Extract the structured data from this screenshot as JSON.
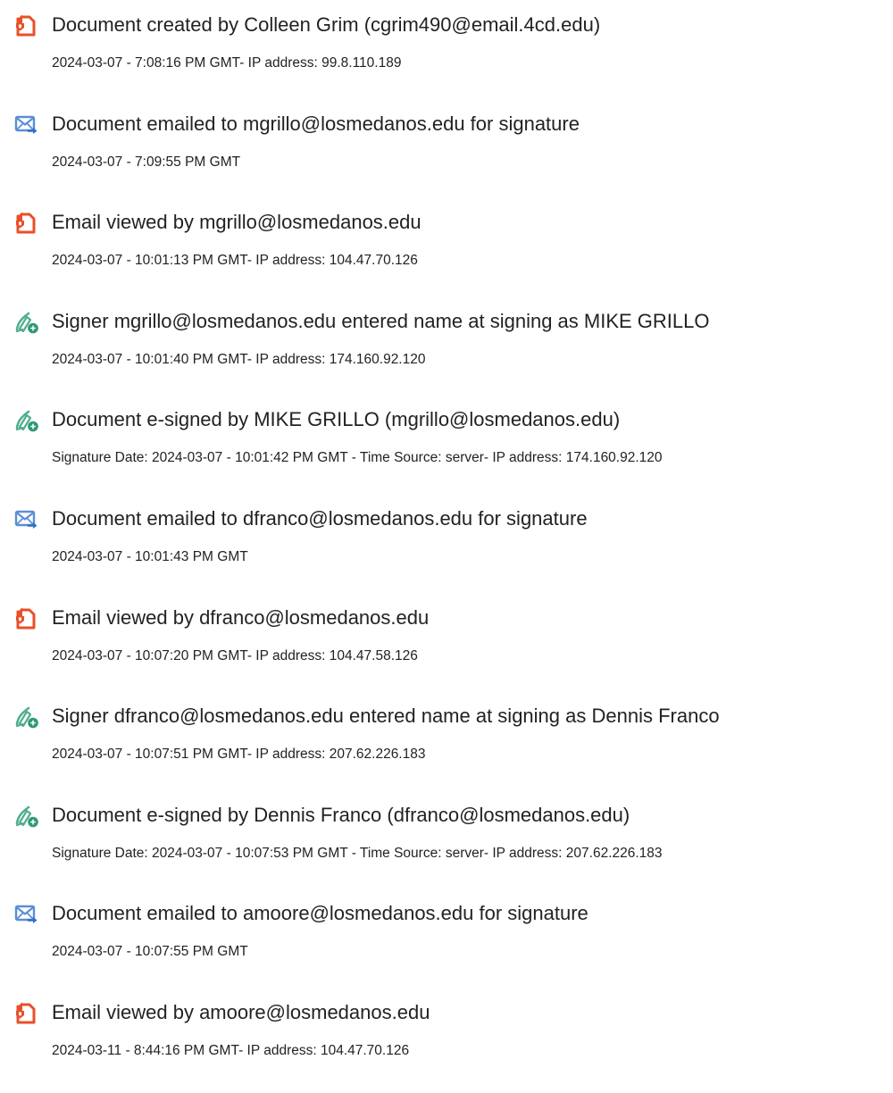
{
  "events": [
    {
      "icon": "document-created-icon",
      "title": "Document created by Colleen Grim (cgrim490@email.4cd.edu)",
      "detail": "2024-03-07 - 7:08:16 PM GMT- IP address: 99.8.110.189"
    },
    {
      "icon": "email-sent-icon",
      "title": "Document emailed to mgrillo@losmedanos.edu for signature",
      "detail": "2024-03-07 - 7:09:55 PM GMT"
    },
    {
      "icon": "document-viewed-icon",
      "title": "Email viewed by mgrillo@losmedanos.edu",
      "detail": "2024-03-07 - 10:01:13 PM GMT- IP address: 104.47.70.126"
    },
    {
      "icon": "signature-pen-icon",
      "title": "Signer mgrillo@losmedanos.edu entered name at signing as MIKE GRILLO",
      "detail": "2024-03-07 - 10:01:40 PM GMT- IP address: 174.160.92.120"
    },
    {
      "icon": "signature-pen-icon",
      "title": "Document e-signed by MIKE GRILLO (mgrillo@losmedanos.edu)",
      "detail": "Signature Date: 2024-03-07 - 10:01:42 PM GMT - Time Source: server- IP address: 174.160.92.120"
    },
    {
      "icon": "email-sent-icon",
      "title": "Document emailed to dfranco@losmedanos.edu for signature",
      "detail": "2024-03-07 - 10:01:43 PM GMT"
    },
    {
      "icon": "document-viewed-icon",
      "title": "Email viewed by dfranco@losmedanos.edu",
      "detail": "2024-03-07 - 10:07:20 PM GMT- IP address: 104.47.58.126"
    },
    {
      "icon": "signature-pen-icon",
      "title": "Signer dfranco@losmedanos.edu entered name at signing as Dennis Franco",
      "detail": "2024-03-07 - 10:07:51 PM GMT- IP address: 207.62.226.183"
    },
    {
      "icon": "signature-pen-icon",
      "title": "Document e-signed by Dennis Franco (dfranco@losmedanos.edu)",
      "detail": "Signature Date: 2024-03-07 - 10:07:53 PM GMT - Time Source: server- IP address: 207.62.226.183"
    },
    {
      "icon": "email-sent-icon",
      "title": "Document emailed to amoore@losmedanos.edu for signature",
      "detail": "2024-03-07 - 10:07:55 PM GMT"
    },
    {
      "icon": "document-viewed-icon",
      "title": "Email viewed by amoore@losmedanos.edu",
      "detail": "2024-03-11 - 8:44:16 PM GMT- IP address: 104.47.70.126"
    }
  ],
  "colors": {
    "document_icon": "#e8502a",
    "email_icon": "#5b8fd6",
    "email_arrow": "#2f6fc4",
    "signature_icon": "#4fae8c",
    "signature_badge": "#2f9a73",
    "text": "#222222"
  }
}
